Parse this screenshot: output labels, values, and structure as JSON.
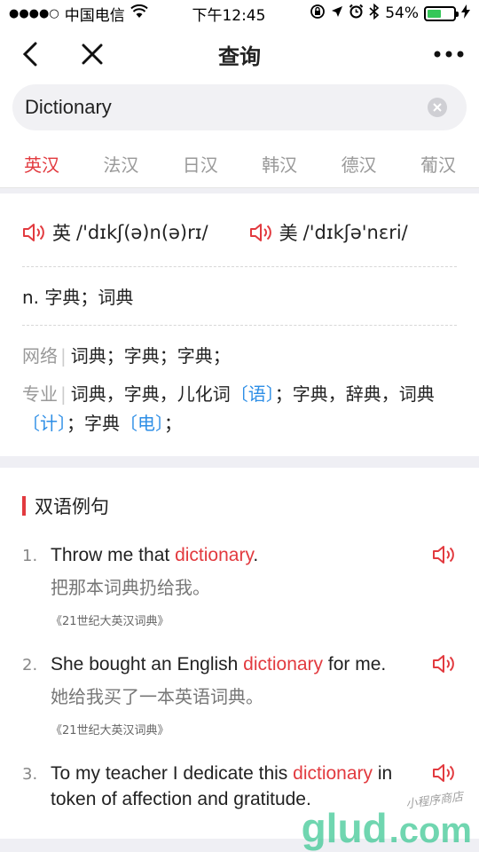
{
  "status_bar": {
    "signal": "●●●●○",
    "carrier": "中国电信",
    "time": "下午12:45",
    "battery_text": "54%",
    "battery_level": 0.54
  },
  "nav": {
    "title": "查询"
  },
  "search": {
    "value": "Dictionary"
  },
  "tabs": [
    "英汉",
    "法汉",
    "日汉",
    "韩汉",
    "德汉",
    "葡汉"
  ],
  "pron": {
    "uk_label": "英",
    "uk_ipa": "/'dɪkʃ(ə)n(ə)rɪ/",
    "us_label": "美",
    "us_ipa": "/'dɪkʃə'nɛri/"
  },
  "definition": "n. 字典；词典",
  "web": {
    "label": "网络",
    "text": "词典；字典；字典；"
  },
  "pro": {
    "label": "专业",
    "p1": "词典，字典，儿化词",
    "t1": "〔语〕",
    "p2": "；字典，辞典，词典",
    "t2": "〔计〕",
    "p3": "；字典",
    "t3": "〔电〕",
    "p4": "；"
  },
  "examples_title": "双语例句",
  "examples": [
    {
      "num": "1.",
      "en_before": "Throw me that ",
      "en_hl": "dictionary",
      "en_after": ".",
      "zh": "把那本词典扔给我。",
      "source": "《21世纪大英汉词典》"
    },
    {
      "num": "2.",
      "en_before": "She bought an English ",
      "en_hl": "dictionary",
      "en_after": " for me.",
      "zh": "她给我买了一本英语词典。",
      "source": "《21世纪大英汉词典》"
    },
    {
      "num": "3.",
      "en_before": "To my teacher I dedicate this ",
      "en_hl": "dictionary",
      "en_after": " in token of affection and gratitude.",
      "zh": "",
      "source": ""
    }
  ],
  "watermark": {
    "big1": "glud",
    "big2": ".com",
    "small": "小程序商店"
  }
}
